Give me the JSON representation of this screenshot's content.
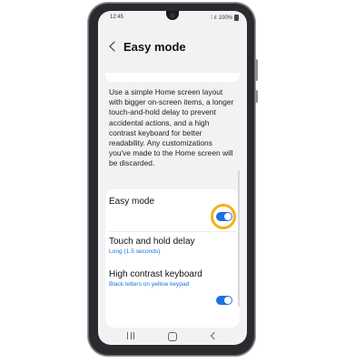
{
  "status": {
    "time": "12:45",
    "signal": "⁞ ıl",
    "battery_text": "100%"
  },
  "header": {
    "title": "Easy mode",
    "back_icon": "chevron-left-icon"
  },
  "description": "Use a simple Home screen layout with bigger on-screen items, a longer touch-and-hold delay to prevent accidental actions, and a high contrast keyboard for better readability. Any customizations you've made to the Home screen will be discarded.",
  "settings": [
    {
      "label": "Easy mode",
      "toggle": true
    },
    {
      "label": "Touch and hold delay",
      "sub": "Long (1.5 seconds)"
    },
    {
      "label": "High contrast keyboard",
      "sub": "Black letters on yellow keypad",
      "toggle": true
    }
  ],
  "colors": {
    "accent": "#1c70e0",
    "highlight_ring": "#f3b01a"
  },
  "nav": {
    "recent_icon": "recent-apps-icon",
    "home_icon": "home-icon",
    "back_icon": "back-icon"
  }
}
